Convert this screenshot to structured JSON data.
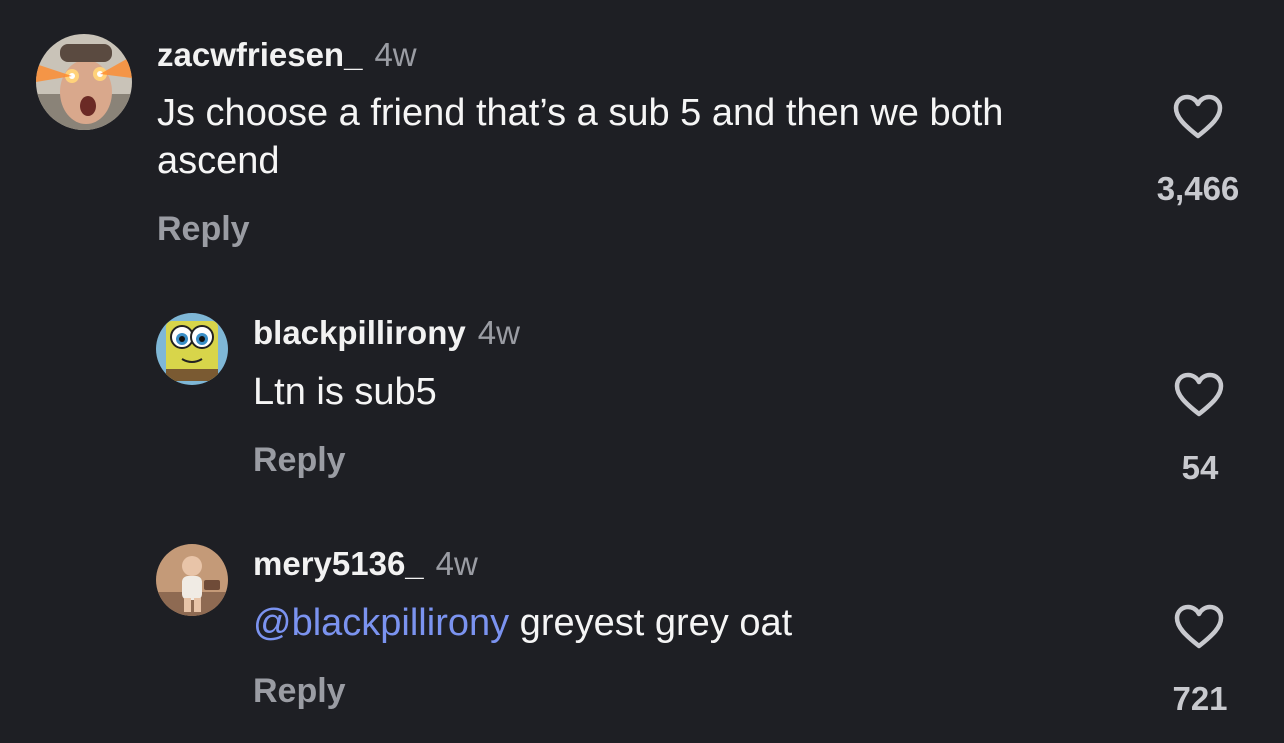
{
  "comments": [
    {
      "username": "zacwfriesen_",
      "time": "4w",
      "text": "Js choose a friend that’s a sub 5 and then we both ascend",
      "reply_label": "Reply",
      "likes": "3,466",
      "avatar_icon": "laser-eyes-avatar"
    },
    {
      "username": "blackpillirony",
      "time": "4w",
      "text": "Ltn is sub5",
      "reply_label": "Reply",
      "likes": "54",
      "avatar_icon": "cartoon-sponge-avatar"
    },
    {
      "username": "mery5136_",
      "time": "4w",
      "mention": "@blackpillirony",
      "text": " greyest grey oat",
      "reply_label": "Reply",
      "likes": "721",
      "avatar_icon": "child-photo-avatar"
    }
  ],
  "colors": {
    "background": "#1e1f24",
    "mention": "#7b93f0",
    "secondary_text": "#9a9ca3"
  }
}
